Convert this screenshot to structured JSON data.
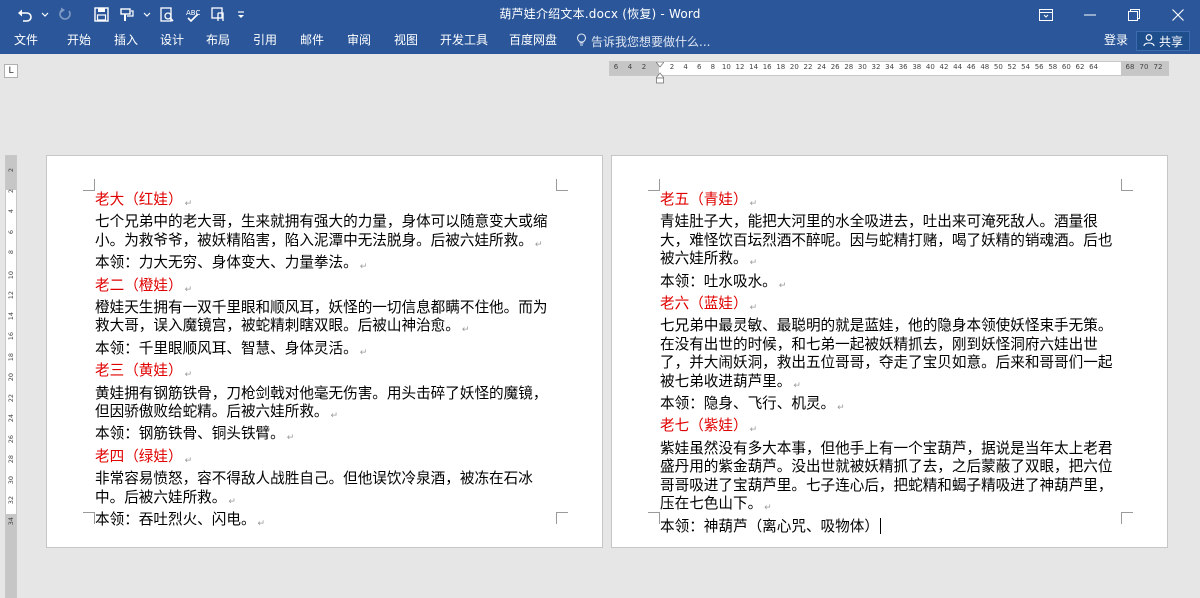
{
  "window": {
    "title": "葫芦娃介绍文本.docx (恢复) - Word",
    "accent": "#2b579a"
  },
  "ribbon": {
    "tabs": [
      "文件",
      "开始",
      "插入",
      "设计",
      "布局",
      "引用",
      "邮件",
      "审阅",
      "视图",
      "开发工具",
      "百度网盘"
    ],
    "tell_me": "告诉我您想要做什么...",
    "login": "登录",
    "share": "共享"
  },
  "ruler": {
    "tab_selector": "L",
    "h_ticks": [
      "6",
      "4",
      "2",
      "2",
      "4",
      "6",
      "8",
      "10",
      "12",
      "14",
      "16",
      "18",
      "20",
      "22",
      "24",
      "26",
      "28",
      "30",
      "32",
      "34",
      "36",
      "38",
      "40",
      "42",
      "44",
      "46",
      "48",
      "50",
      "52",
      "54",
      "56",
      "58",
      "60",
      "62",
      "64",
      "68",
      "70",
      "72"
    ],
    "v_ticks": [
      "2",
      "2",
      "4",
      "6",
      "8",
      "10",
      "12",
      "14",
      "16",
      "18",
      "20",
      "22",
      "24",
      "26",
      "28",
      "30",
      "32",
      "34"
    ]
  },
  "document": {
    "heading_color": "#e00000",
    "left_page": [
      {
        "text": "老大（红娃）",
        "heading": true
      },
      {
        "text": "七个兄弟中的老大哥，生来就拥有强大的力量，身体可以随意变大或缩小。为救爷爷，被妖精陷害，陷入泥潭中无法脱身。后被六娃所救。",
        "heading": false
      },
      {
        "text": "本领：力大无穷、身体变大、力量拳法。",
        "heading": false
      },
      {
        "text": "老二（橙娃）",
        "heading": true
      },
      {
        "text": "橙娃天生拥有一双千里眼和顺风耳，妖怪的一切信息都瞒不住他。而为救大哥，误入魔镜宫，被蛇精刺瞎双眼。后被山神治愈。",
        "heading": false
      },
      {
        "text": "本领：千里眼顺风耳、智慧、身体灵活。",
        "heading": false
      },
      {
        "text": "老三（黄娃）",
        "heading": true
      },
      {
        "text": "黄娃拥有钢筋铁骨，刀枪剑戟对他毫无伤害。用头击碎了妖怪的魔镜，但因骄傲败给蛇精。后被六娃所救。",
        "heading": false
      },
      {
        "text": "本领：钢筋铁骨、铜头铁臂。",
        "heading": false
      },
      {
        "text": "老四（绿娃）",
        "heading": true
      },
      {
        "text": "非常容易愤怒，容不得敌人战胜自己。但他误饮冷泉酒，被冻在石冰中。后被六娃所救。",
        "heading": false
      },
      {
        "text": "本领：吞吐烈火、闪电。",
        "heading": false
      }
    ],
    "right_page": [
      {
        "text": "老五（青娃）",
        "heading": true
      },
      {
        "text": "青娃肚子大，能把大河里的水全吸进去，吐出来可淹死敌人。酒量很大，难怪饮百坛烈酒不醉呢。因与蛇精打赌，喝了妖精的销魂酒。后也被六娃所救。",
        "heading": false
      },
      {
        "text": "本领：吐水吸水。",
        "heading": false
      },
      {
        "text": "老六（蓝娃）",
        "heading": true
      },
      {
        "text": "七兄弟中最灵敏、最聪明的就是蓝娃，他的隐身本领使妖怪束手无策。在没有出世的时候，和七弟一起被妖精抓去，刚到妖怪洞府六娃出世了，并大闹妖洞，救出五位哥哥，夺走了宝贝如意。后来和哥哥们一起被七弟收进葫芦里。",
        "heading": false
      },
      {
        "text": "本领：隐身、飞行、机灵。",
        "heading": false
      },
      {
        "text": "老七（紫娃）",
        "heading": true
      },
      {
        "text": "紫娃虽然没有多大本事，但他手上有一个宝葫芦，据说是当年太上老君盛丹用的紫金葫芦。没出世就被妖精抓了去，之后蒙蔽了双眼，把六位哥哥吸进了宝葫芦里。七子连心后，把蛇精和蝎子精吸进了神葫芦里，压在七色山下。",
        "heading": false
      },
      {
        "text": "本领：神葫芦（离心咒、吸物体）",
        "heading": false
      }
    ]
  }
}
